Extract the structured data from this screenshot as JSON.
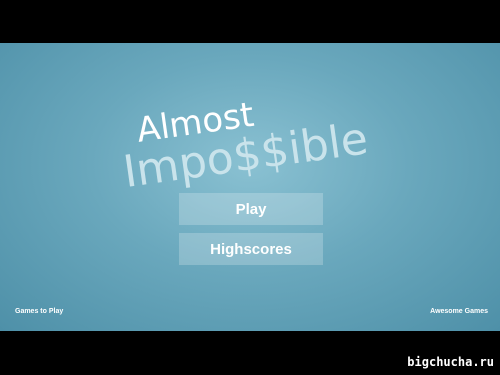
{
  "logo": {
    "line1": "Almost",
    "line2": "Impo$$ible"
  },
  "menu": {
    "play_label": "Play",
    "highscores_label": "Highscores"
  },
  "footer": {
    "left_link": "Games to Play",
    "right_link": "Awesome Games"
  },
  "watermark": "bigchucha.ru",
  "colors": {
    "background": "#6aa8bd",
    "letterbox": "#000000",
    "text": "#ffffff",
    "logo_secondary": "#c9e3eb"
  }
}
